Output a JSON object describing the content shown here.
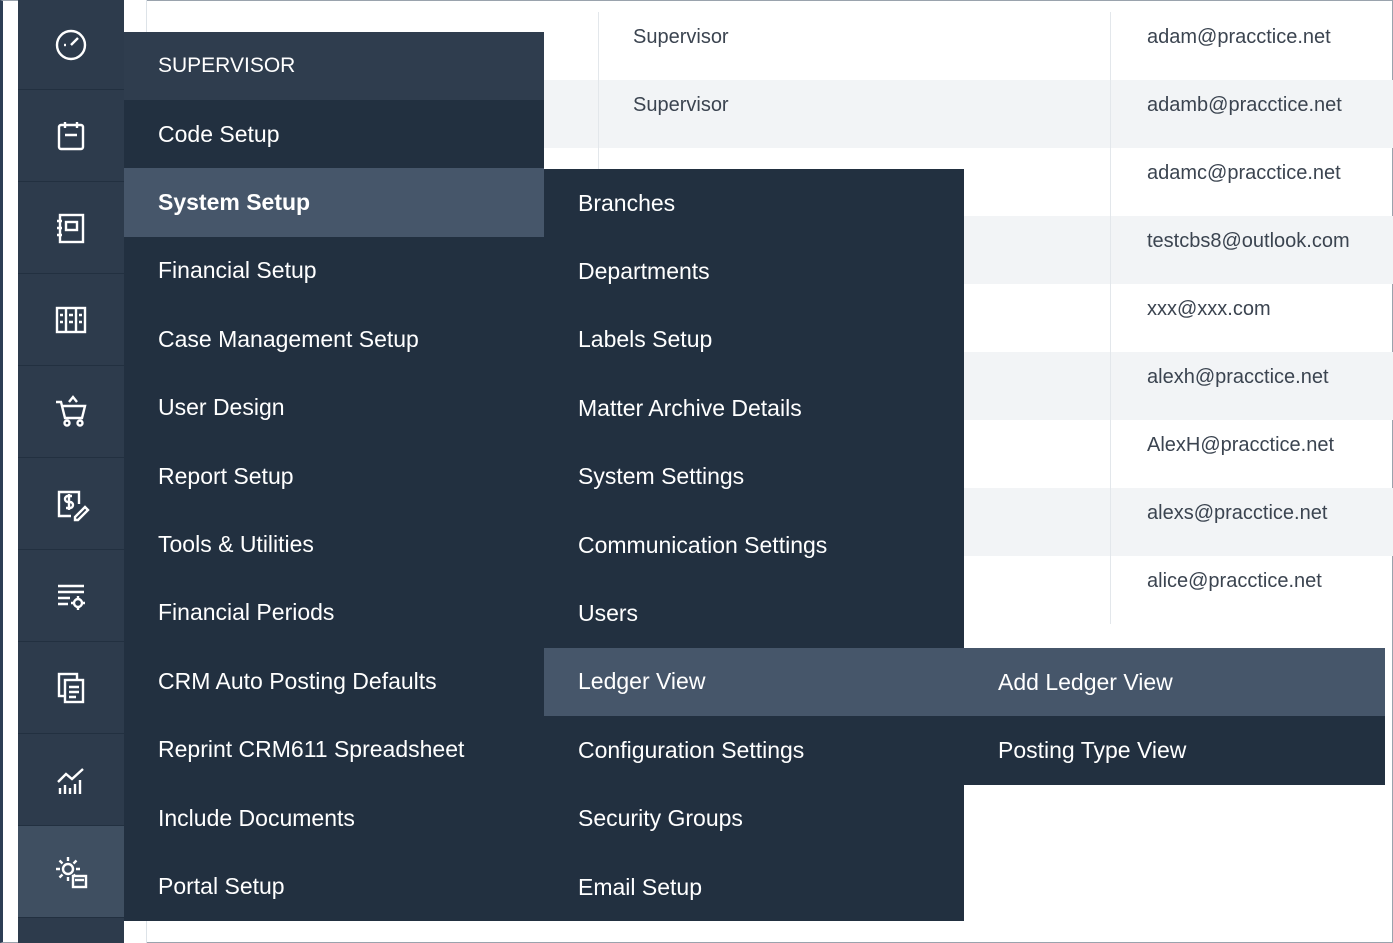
{
  "rail": {
    "icons": [
      "dashboard-icon",
      "calendar-icon",
      "contacts-book-icon",
      "ledger-icon",
      "cart-icon",
      "billing-icon",
      "list-settings-icon",
      "documents-icon",
      "analytics-icon",
      "system-settings-icon"
    ]
  },
  "table": {
    "rows": [
      {
        "role": "Supervisor",
        "email": "adam@pracctice.net"
      },
      {
        "role": "Supervisor",
        "email": "adamb@pracctice.net"
      },
      {
        "role": "",
        "email": "adamc@pracctice.net"
      },
      {
        "role": "",
        "email": "testcbs8@outlook.com"
      },
      {
        "role": "",
        "email": "xxx@xxx.com"
      },
      {
        "role": "",
        "email": "alexh@pracctice.net"
      },
      {
        "role": "",
        "email": "AlexH@pracctice.net"
      },
      {
        "role": "",
        "email": "alexs@pracctice.net"
      },
      {
        "role": "",
        "email": "alice@pracctice.net"
      }
    ]
  },
  "menu_main": {
    "header": "SUPERVISOR",
    "items": [
      "Code Setup",
      "System Setup",
      "Financial Setup",
      "Case Management Setup",
      "User Design",
      "Report Setup",
      "Tools & Utilities",
      "Financial Periods",
      "CRM Auto Posting Defaults",
      "Reprint CRM611 Spreadsheet",
      "Include Documents",
      "Portal Setup"
    ]
  },
  "menu_system_setup": {
    "items": [
      "Branches",
      "Departments",
      "Labels Setup",
      "Matter Archive Details",
      "System Settings",
      "Communication Settings",
      "Users",
      "Ledger View",
      "Configuration Settings",
      "Security Groups",
      "Email Setup"
    ]
  },
  "menu_ledger_view": {
    "items": [
      "Add Ledger View",
      "Posting Type View"
    ]
  },
  "colors": {
    "rail": "#2d3b4c",
    "menu": "#223040",
    "menu_highlight": "#46566a"
  }
}
